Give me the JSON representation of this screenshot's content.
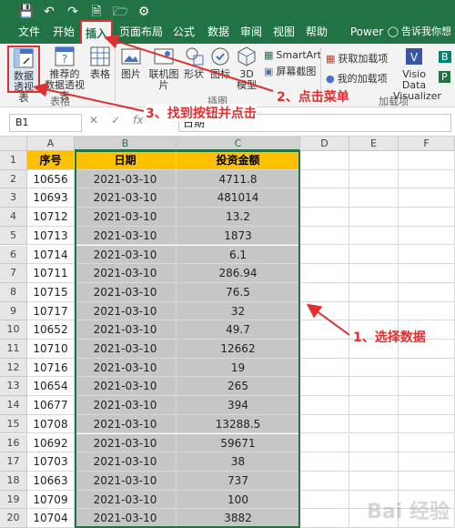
{
  "titlebar": {
    "tabs": [
      "文件",
      "开始",
      "插入",
      "页面布局",
      "公式",
      "数据",
      "审阅",
      "视图",
      "帮助",
      "Power Pivot"
    ],
    "active_tab": "插入",
    "tell_me": "告诉我你想"
  },
  "ribbon": {
    "pivot": "数据\n透视表",
    "rec_pivot": "推荐的\n数据透视表",
    "table": "表格",
    "group_tables": "表格",
    "picture": "图片",
    "online_picture": "联机图片",
    "shapes": "形状",
    "icons": "图标",
    "models": "3D\n模型",
    "smartart": "SmartArt",
    "screenshot": "屏幕截图",
    "group_illustrations": "插图",
    "get_addins": "获取加载项",
    "my_addins": "我的加载项",
    "group_addins": "加载项",
    "visio": "Visio Data\nVisualizer",
    "bing": "B",
    "people": "P"
  },
  "formula_bar": {
    "namebox": "B1",
    "formula": "日期"
  },
  "columns": [
    "A",
    "B",
    "C",
    "D",
    "E",
    "F"
  ],
  "headers": [
    "序号",
    "日期",
    "投资金额"
  ],
  "rows": [
    [
      "10656",
      "2021-03-10",
      "4711.8"
    ],
    [
      "10693",
      "2021-03-10",
      "481014"
    ],
    [
      "10712",
      "2021-03-10",
      "13.2"
    ],
    [
      "10713",
      "2021-03-10",
      "1873"
    ],
    [
      "10714",
      "2021-03-10",
      "6.1"
    ],
    [
      "10711",
      "2021-03-10",
      "286.94"
    ],
    [
      "10715",
      "2021-03-10",
      "76.5"
    ],
    [
      "10717",
      "2021-03-10",
      "32"
    ],
    [
      "10652",
      "2021-03-10",
      "49.7"
    ],
    [
      "10710",
      "2021-03-10",
      "12662"
    ],
    [
      "10716",
      "2021-03-10",
      "19"
    ],
    [
      "10654",
      "2021-03-10",
      "265"
    ],
    [
      "10677",
      "2021-03-10",
      "394"
    ],
    [
      "10708",
      "2021-03-10",
      "13288.5"
    ],
    [
      "10692",
      "2021-03-10",
      "59671"
    ],
    [
      "10703",
      "2021-03-10",
      "38"
    ],
    [
      "10663",
      "2021-03-10",
      "737"
    ],
    [
      "10709",
      "2021-03-10",
      "100"
    ],
    [
      "10704",
      "2021-03-10",
      "3882"
    ]
  ],
  "annotations": {
    "step1": "1、选择数据",
    "step2": "2、点击菜单",
    "step3": "3、找到按钮并点击"
  },
  "colors": {
    "excel_green": "#217346",
    "header_fill": "#ffc000",
    "selection_fill": "#c6c6c6",
    "annotation_red": "#e03030"
  },
  "watermark": "Bai 经验"
}
